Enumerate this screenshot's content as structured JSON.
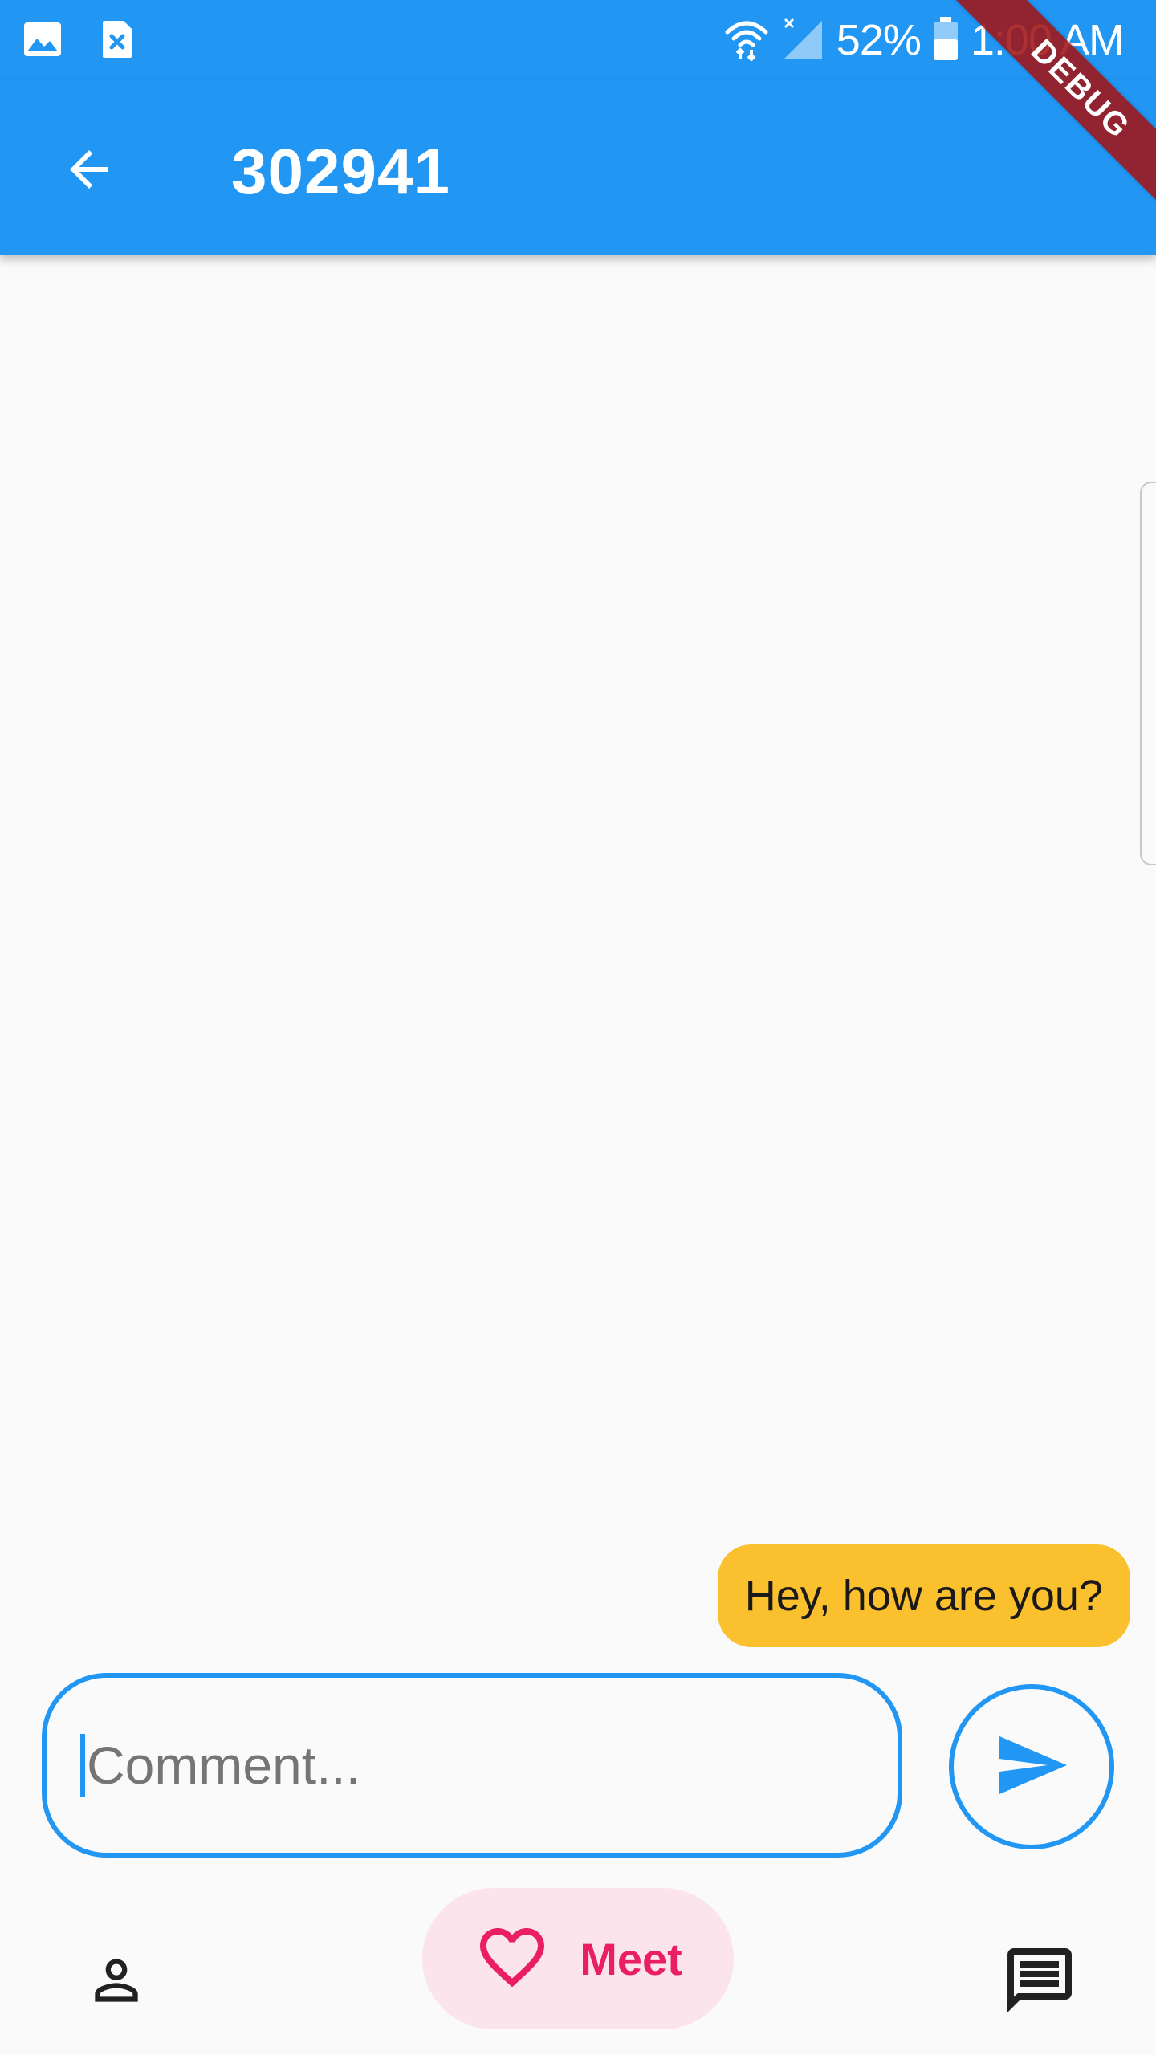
{
  "status_bar": {
    "icons_left": [
      "image-icon",
      "file-close-icon"
    ],
    "icons_right": [
      "wifi-icon",
      "signal-icon",
      "battery-icon"
    ],
    "battery_percent": "52%",
    "time": "1:00 AM"
  },
  "debug_banner": {
    "label": "DEBUG"
  },
  "app_bar": {
    "title": "302941",
    "back_icon": "arrow-back-icon"
  },
  "messages": [
    {
      "text": "Hey, how are you?"
    }
  ],
  "composer": {
    "placeholder": "Comment...",
    "value": "",
    "send_icon": "send-icon"
  },
  "bottom_nav": {
    "items": [
      {
        "icon": "person-icon",
        "label": ""
      },
      {
        "icon": "heart-icon",
        "label": "Meet",
        "selected": true
      },
      {
        "icon": "chat-icon",
        "label": ""
      }
    ]
  },
  "colors": {
    "primary": "#2196f3",
    "bubble": "#fbc02d",
    "accent": "#e91e63",
    "selected_pill": "#fce4ec",
    "debug": "#a01414"
  }
}
